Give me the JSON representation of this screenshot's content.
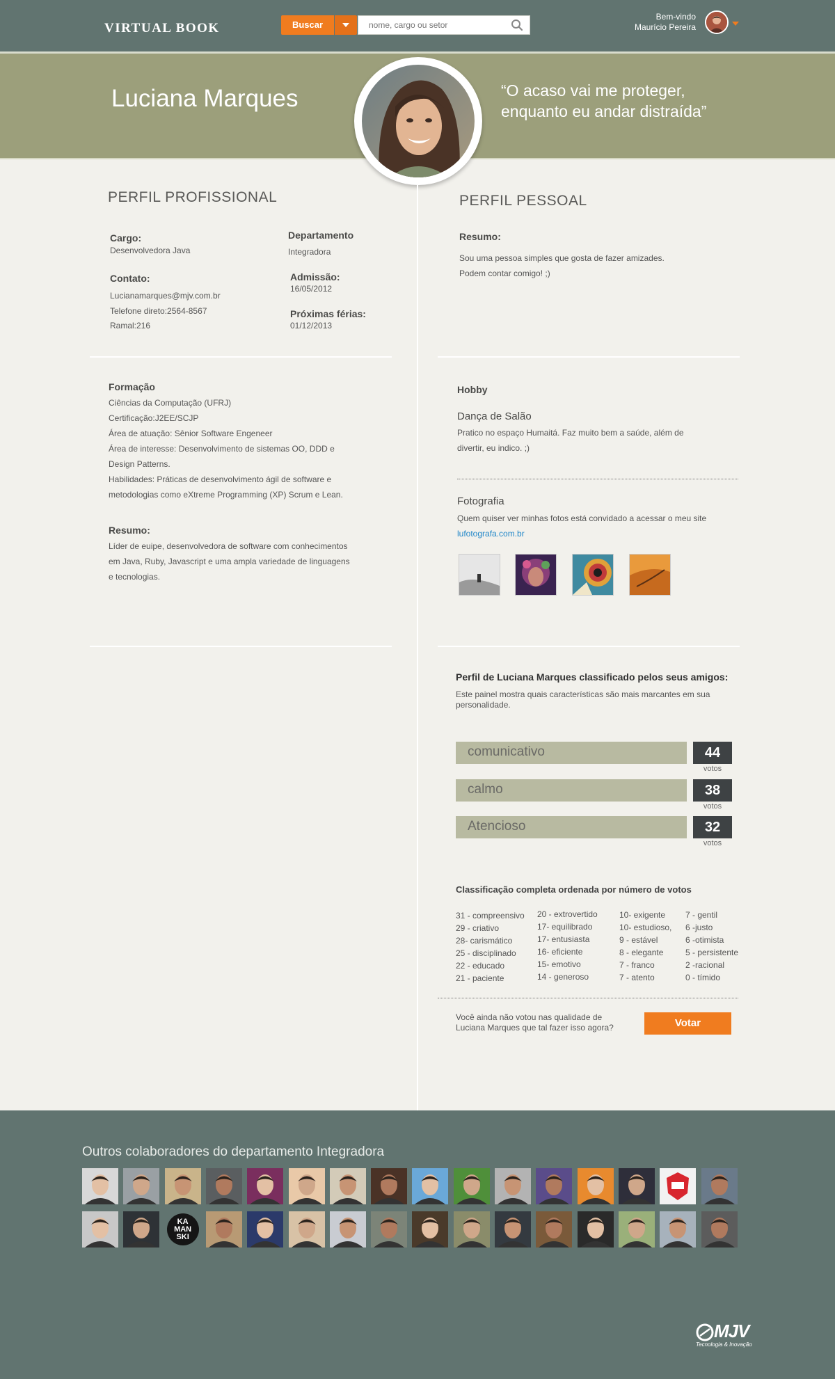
{
  "header": {
    "logo": "VIRTUAL BOOK",
    "search_button": "Buscar",
    "search_placeholder": "nome, cargo ou setor",
    "welcome": "Bem-vindo",
    "user_name": "Maurício Pereira"
  },
  "profile": {
    "name": "Luciana Marques",
    "quote_line1": "“O acaso vai me proteger,",
    "quote_line2": "enquanto eu andar distraída”"
  },
  "professional": {
    "title": "PERFIL PROFISSIONAL",
    "cargo_label": "Cargo:",
    "cargo": "Desenvolvedora Java",
    "departamento_label": "Departamento",
    "departamento": "Integradora",
    "contato_label": "Contato:",
    "email": "Lucianamarques@mjv.com.br",
    "telefone": "Telefone direto:2564-8567",
    "ramal": "Ramal:216",
    "admissao_label": "Admissão:",
    "admissao": "16/05/2012",
    "ferias_label": "Próximas férias:",
    "ferias": "01/12/2013",
    "formacao_label": "Formação",
    "formacao": [
      "Ciências da Computação (UFRJ)",
      "Certificação:J2EE/SCJP",
      "Área de atuação: Sênior Software Engeneer",
      "Área de interesse: Desenvolvimento de sistemas OO, DDD e",
      "Design Patterns.",
      "Habilidades: Práticas de desenvolvimento ágil de software e",
      "metodologias como eXtreme Programming (XP) Scrum e Lean."
    ],
    "resumo_label": "Resumo:",
    "resumo": [
      "Líder de euipe, desenvolvedora de software com conhecimentos",
      "em Java, Ruby, Javascript e uma ampla variedade de linguagens",
      "e tecnologias."
    ]
  },
  "personal": {
    "title": "PERFIL PESSOAL",
    "resumo_label": "Resumo:",
    "resumo": [
      "Sou uma pessoa simples que gosta de fazer amizades.",
      "Podem contar comigo! ;)"
    ],
    "hobby_label": "Hobby",
    "hobby1_title": "Dança de Salão",
    "hobby1_text": [
      "Pratico no espaço Humaitá. Faz muito bem a saúde, além de",
      "divertir, eu indico. ;)"
    ],
    "hobby2_title": "Fotografia",
    "hobby2_text": "Quem quiser ver minhas fotos está convidado a acessar o meu site",
    "hobby2_link": "lufotografa.com.br"
  },
  "ratings": {
    "title": "Perfil de Luciana Marques classificado pelos seus amigos:",
    "subtitle_line1": "Este painel mostra quais características são mais marcantes em sua",
    "subtitle_line2": "personalidade.",
    "top": [
      {
        "trait": "comunicativo",
        "votes": "44",
        "unit": "votos"
      },
      {
        "trait": "calmo",
        "votes": "38",
        "unit": "votos"
      },
      {
        "trait": "Atencioso",
        "votes": "32",
        "unit": "votos"
      }
    ],
    "full_title": "Classificação completa ordenada por número de votos",
    "columns": [
      [
        "31 - compreensivo",
        "29 - criativo",
        "28- carismático",
        "25 - disciplinado",
        "22 - educado",
        "21 - paciente"
      ],
      [
        "20 - extrovertido",
        "17- equilibrado",
        "17- entusiasta",
        "16- eficiente",
        "15- emotivo",
        "14 - generoso"
      ],
      [
        "10- exigente",
        "10- estudioso,",
        "9 - estável",
        "8 - elegante",
        "7 - franco",
        "7 - atento"
      ],
      [
        "7 - gentil",
        "6 -justo",
        "6 -otimista",
        "5 - persistente",
        "2 -racional",
        "0 - tímido"
      ]
    ],
    "vote_prompt_line1": "Você ainda não votou nas qualidade de",
    "vote_prompt_line2": "Luciana Marques  que tal fazer isso agora?",
    "vote_button": "Votar"
  },
  "footer": {
    "title": "Outros colaboradores do departamento Integradora",
    "badge_text": "KA MAN SKI",
    "brand": "MJV",
    "brand_tagline": "Tecnologia & Inovação"
  },
  "colors": {
    "accent": "#f07c1f",
    "header": "#617470",
    "banner": "#9c9f7b",
    "trait_bar": "#b8baa1",
    "vote_box": "#3e4244",
    "link": "#1f86c8"
  }
}
